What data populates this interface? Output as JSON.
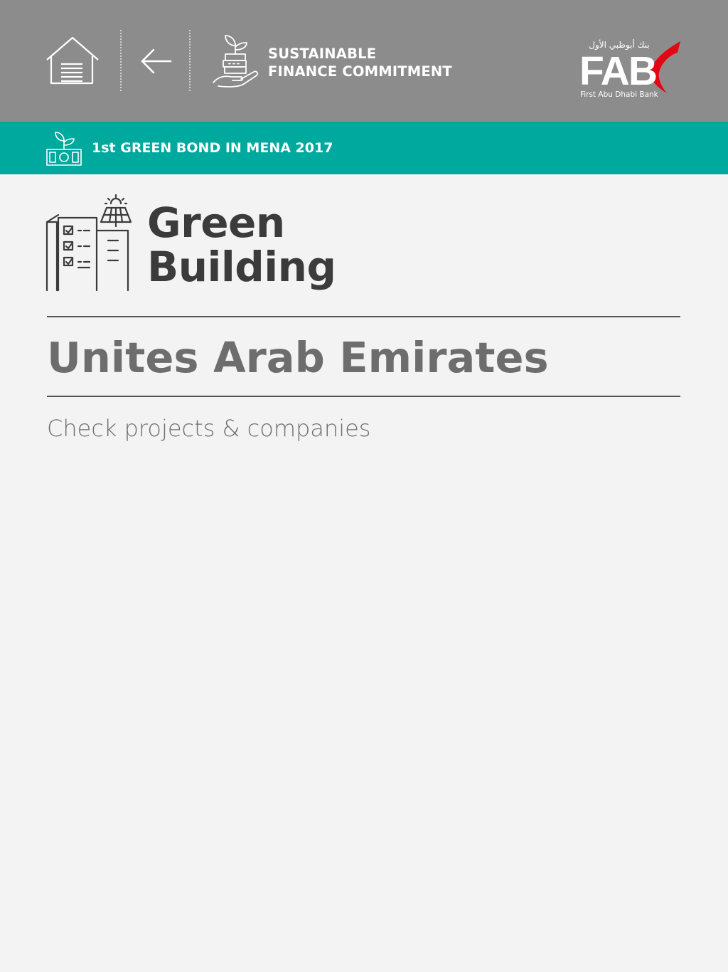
{
  "header": {
    "home_icon": "home-icon",
    "back_icon": "arrow-left-icon",
    "section_icon": "plant-coins-hand-icon",
    "section_title_line1": "SUSTAINABLE",
    "section_title_line2": "FINANCE COMMITMENT",
    "background_color": "#8c8c8c"
  },
  "logo": {
    "arabic_text": "بنك أبوظبي الأول",
    "wordmark": "FAB",
    "subtitle": "First Abu Dhabi Bank",
    "accent_color": "#e30613"
  },
  "banner": {
    "icon": "plant-money-icon",
    "text": "1st GREEN BOND IN MENA 2017",
    "background_color": "#00a99d"
  },
  "category": {
    "icon": "green-building-solar-icon",
    "title_line1": "Green",
    "title_line2": "Building"
  },
  "country": {
    "name": "Unites Arab Emirates"
  },
  "link": {
    "label": "Check projects & companies"
  }
}
